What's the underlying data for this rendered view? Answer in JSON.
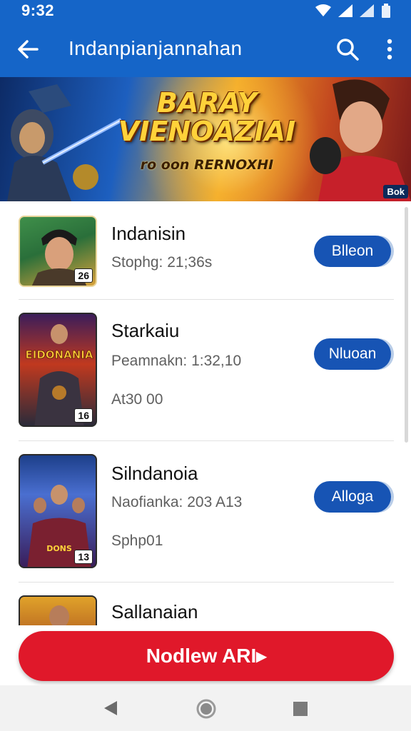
{
  "status_bar": {
    "time": "9:32"
  },
  "app_bar": {
    "title": "Indanpianjannahan"
  },
  "banner": {
    "title": "BARAY VIENOAZIAI",
    "subtitle": "ro oon RERNOXHI",
    "corner": "Bok"
  },
  "items": [
    {
      "name": "Indanisin",
      "line1": "Stophg: 21;36s",
      "line2": "",
      "badge": "26",
      "button": "Blleon"
    },
    {
      "name": "Starkaiu",
      "line1": "Peamnakn: 1:32,10",
      "line2": "At30 00",
      "badge": "16",
      "button": "Nluoan"
    },
    {
      "name": "Silndanoia",
      "line1": "Naofianka: 203 A13",
      "line2": "Sphp01",
      "badge": "13",
      "button": "Alloga"
    },
    {
      "name": "Sallanaian",
      "line1": "",
      "line2": "",
      "badge": "",
      "button": ""
    }
  ],
  "cta": {
    "label": "Nodlew ARI▸"
  },
  "colors": {
    "primary": "#1565c8",
    "button": "#1754b4",
    "cta": "#e0182a"
  }
}
